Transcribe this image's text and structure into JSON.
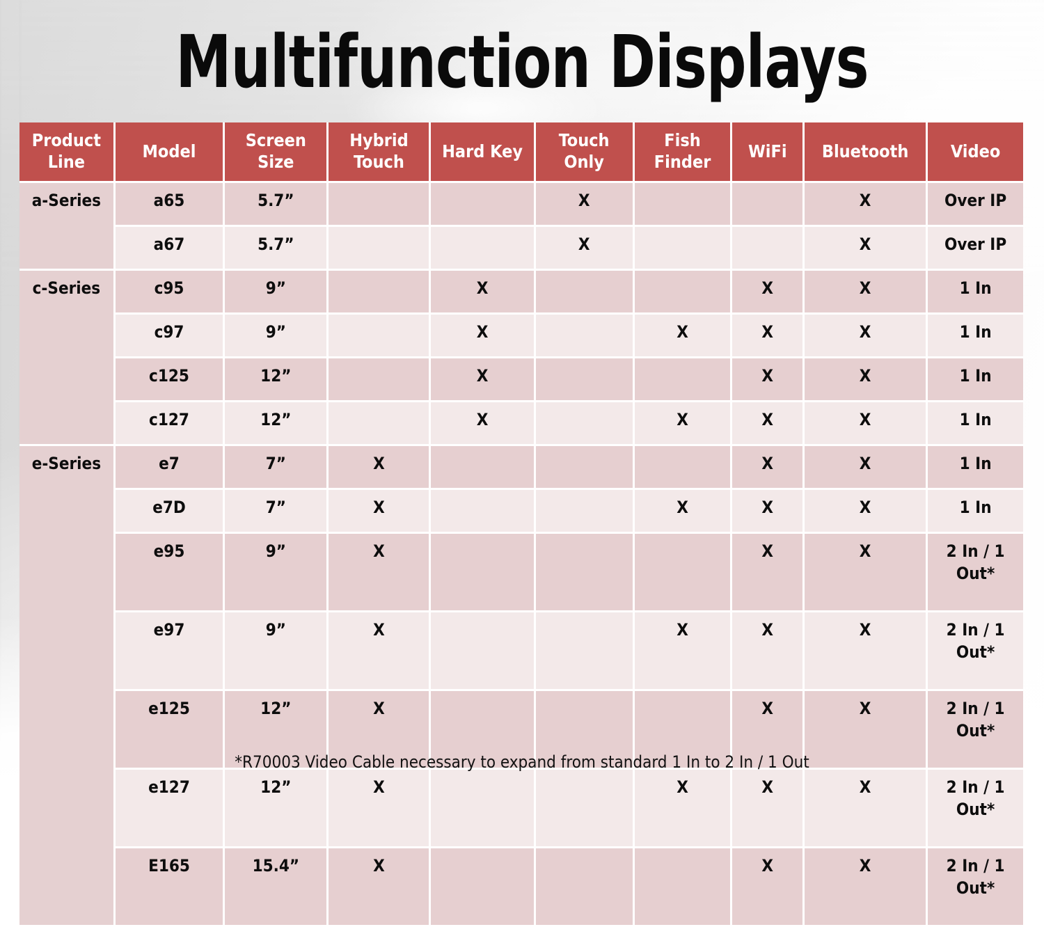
{
  "slide": {
    "title": "Multifunction Displays",
    "footnote": "*R70003 Video Cable necessary to expand from standard 1 In to 2 In / 1 Out"
  },
  "colors": {
    "header_red": "#c0504d",
    "row_dark": "#e6cfd0",
    "row_light": "#f3e9e9",
    "product_line_cell": "#e5d0d1",
    "header_text": "#ffffff",
    "body_text": "#0d0d0d",
    "grid_line": "#ffffff"
  },
  "table": {
    "columns": [
      {
        "key": "product_line",
        "label": "Product Line"
      },
      {
        "key": "model",
        "label": "Model"
      },
      {
        "key": "screen_size",
        "label": "Screen Size"
      },
      {
        "key": "hybrid_touch",
        "label": "Hybrid Touch"
      },
      {
        "key": "hard_key",
        "label": "Hard Key"
      },
      {
        "key": "touch_only",
        "label": "Touch Only"
      },
      {
        "key": "fish_finder",
        "label": "Fish Finder"
      },
      {
        "key": "wifi",
        "label": "WiFi"
      },
      {
        "key": "bluetooth",
        "label": "Bluetooth"
      },
      {
        "key": "video",
        "label": "Video"
      }
    ],
    "mark": "X",
    "groups": [
      {
        "product_line": "a-Series",
        "rows": [
          {
            "model": "a65",
            "screen_size": "5.7”",
            "hybrid_touch": "",
            "hard_key": "",
            "touch_only": "X",
            "fish_finder": "",
            "wifi": "",
            "bluetooth": "X",
            "video": "Over IP"
          },
          {
            "model": "a67",
            "screen_size": "5.7”",
            "hybrid_touch": "",
            "hard_key": "",
            "touch_only": "X",
            "fish_finder": "",
            "wifi": "",
            "bluetooth": "X",
            "video": "Over IP"
          }
        ]
      },
      {
        "product_line": "c-Series",
        "rows": [
          {
            "model": "c95",
            "screen_size": "9”",
            "hybrid_touch": "",
            "hard_key": "X",
            "touch_only": "",
            "fish_finder": "",
            "wifi": "X",
            "bluetooth": "X",
            "video": "1 In"
          },
          {
            "model": "c97",
            "screen_size": "9”",
            "hybrid_touch": "",
            "hard_key": "X",
            "touch_only": "",
            "fish_finder": "X",
            "wifi": "X",
            "bluetooth": "X",
            "video": "1 In"
          },
          {
            "model": "c125",
            "screen_size": "12”",
            "hybrid_touch": "",
            "hard_key": "X",
            "touch_only": "",
            "fish_finder": "",
            "wifi": "X",
            "bluetooth": "X",
            "video": "1 In"
          },
          {
            "model": "c127",
            "screen_size": "12”",
            "hybrid_touch": "",
            "hard_key": "X",
            "touch_only": "",
            "fish_finder": "X",
            "wifi": "X",
            "bluetooth": "X",
            "video": "1 In"
          }
        ]
      },
      {
        "product_line": "e-Series",
        "rows": [
          {
            "model": "e7",
            "screen_size": "7”",
            "hybrid_touch": "X",
            "hard_key": "",
            "touch_only": "",
            "fish_finder": "",
            "wifi": "X",
            "bluetooth": "X",
            "video": "1 In"
          },
          {
            "model": "e7D",
            "screen_size": "7”",
            "hybrid_touch": "X",
            "hard_key": "",
            "touch_only": "",
            "fish_finder": "X",
            "wifi": "X",
            "bluetooth": "X",
            "video": "1 In"
          },
          {
            "model": "e95",
            "screen_size": "9”",
            "hybrid_touch": "X",
            "hard_key": "",
            "touch_only": "",
            "fish_finder": "",
            "wifi": "X",
            "bluetooth": "X",
            "video": "2 In / 1 Out*"
          },
          {
            "model": "e97",
            "screen_size": "9”",
            "hybrid_touch": "X",
            "hard_key": "",
            "touch_only": "",
            "fish_finder": "X",
            "wifi": "X",
            "bluetooth": "X",
            "video": "2 In / 1 Out*"
          },
          {
            "model": "e125",
            "screen_size": "12”",
            "hybrid_touch": "X",
            "hard_key": "",
            "touch_only": "",
            "fish_finder": "",
            "wifi": "X",
            "bluetooth": "X",
            "video": "2 In / 1 Out*"
          },
          {
            "model": "e127",
            "screen_size": "12”",
            "hybrid_touch": "X",
            "hard_key": "",
            "touch_only": "",
            "fish_finder": "X",
            "wifi": "X",
            "bluetooth": "X",
            "video": "2 In / 1 Out*"
          },
          {
            "model": "E165",
            "screen_size": "15.4”",
            "hybrid_touch": "X",
            "hard_key": "",
            "touch_only": "",
            "fish_finder": "",
            "wifi": "X",
            "bluetooth": "X",
            "video": "2 In / 1 Out*"
          }
        ]
      }
    ]
  }
}
